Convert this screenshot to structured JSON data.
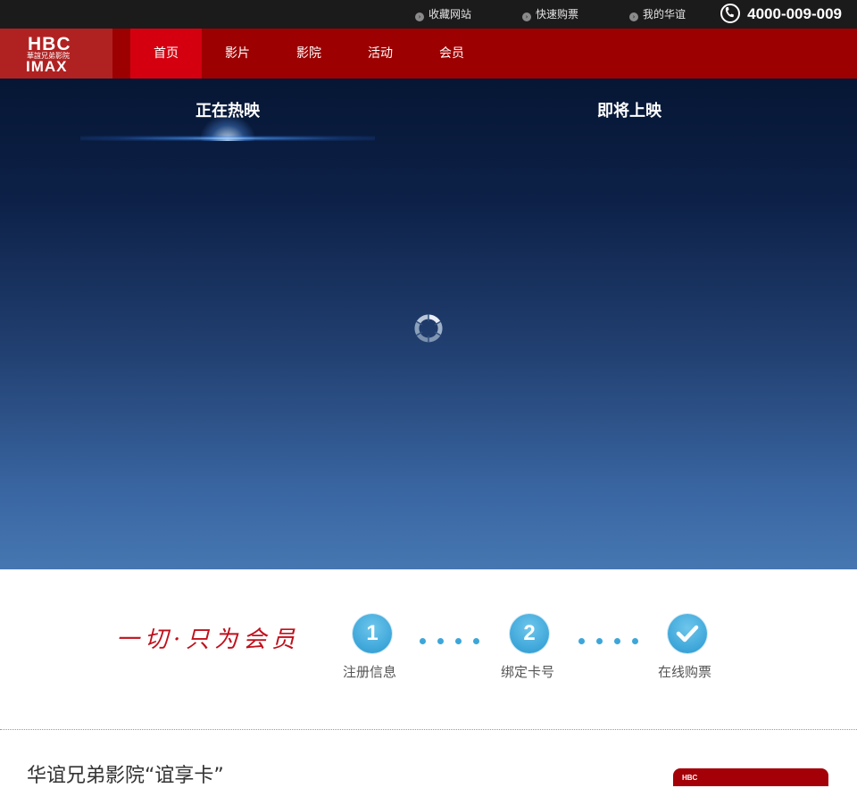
{
  "topbar": {
    "links": [
      {
        "label": "收藏网站"
      },
      {
        "label": "快速购票"
      },
      {
        "label": "我的华谊"
      }
    ],
    "phone": "4000-009-009"
  },
  "logo": {
    "line1": "HBC",
    "line2": "華誼兄弟影院",
    "line3": "IMAX"
  },
  "nav": {
    "items": [
      {
        "label": "首页",
        "active": true
      },
      {
        "label": "影片",
        "active": false
      },
      {
        "label": "影院",
        "active": false
      },
      {
        "label": "活动",
        "active": false
      },
      {
        "label": "会员",
        "active": false
      }
    ]
  },
  "hero": {
    "tabs": [
      {
        "label": "正在热映",
        "active": true
      },
      {
        "label": "即将上映",
        "active": false
      }
    ]
  },
  "member": {
    "slogan": "一切·只为会员",
    "steps": [
      {
        "number": "1",
        "label": "注册信息"
      },
      {
        "number": "2",
        "label": "绑定卡号"
      },
      {
        "number": "check",
        "label": "在线购票"
      }
    ]
  },
  "card_section": {
    "title": "华谊兄弟影院“谊享卡”",
    "thumb_label": "HBC"
  },
  "colors": {
    "topbar": "#1b1b1b",
    "nav": "#9c0000",
    "nav_active": "#d40010",
    "step": "#3da6d9"
  }
}
